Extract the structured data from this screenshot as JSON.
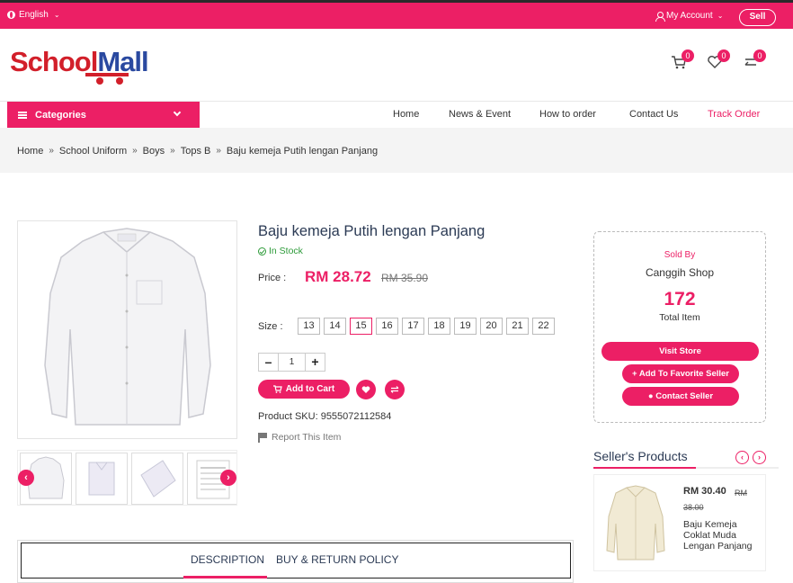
{
  "topbar": {
    "language": "English",
    "account": "My Account",
    "sell": "Sell"
  },
  "logo": {
    "part1": "School",
    "part2": "Mall"
  },
  "header_icons": [
    {
      "icon": "cart-icon",
      "count": "0"
    },
    {
      "icon": "heart-icon",
      "count": "0"
    },
    {
      "icon": "compare-icon",
      "count": "0"
    }
  ],
  "nav": {
    "categories": "Categories",
    "items": [
      "Home",
      "News & Event",
      "How to order",
      "Contact Us",
      "Track Order"
    ]
  },
  "breadcrumb": [
    "Home",
    "School Uniform",
    "Boys",
    "Tops B",
    "Baju kemeja Putih lengan Panjang"
  ],
  "product": {
    "title": "Baju kemeja Putih lengan Panjang",
    "stock": "In Stock",
    "price_label": "Price :",
    "price": "RM 28.72",
    "old_price": "RM 35.90",
    "size_label": "Size :",
    "sizes": [
      "13",
      "14",
      "15",
      "16",
      "17",
      "18",
      "19",
      "20",
      "21",
      "22"
    ],
    "selected_size": "15",
    "quantity": "1",
    "add_to_cart": "Add to Cart",
    "sku": "Product SKU: 9555072112584",
    "report": "Report This Item"
  },
  "seller": {
    "sold_by": "Sold By",
    "name": "Canggih Shop",
    "total_items": "172",
    "total_label": "Total Item",
    "visit": "Visit Store",
    "favorite": "Add To Favorite Seller",
    "contact": "Contact Seller"
  },
  "sellers_products": {
    "heading": "Seller's Products",
    "items": [
      {
        "price": "RM 30.40",
        "old_price": "RM 38.00",
        "name": "Baju Kemeja Coklat Muda Lengan Panjang"
      }
    ]
  },
  "tabs": [
    "DESCRIPTION",
    "BUY & RETURN POLICY"
  ],
  "colors": {
    "accent": "#ec1f65",
    "heading": "#2c3b55",
    "stock": "#2e9b3a"
  }
}
